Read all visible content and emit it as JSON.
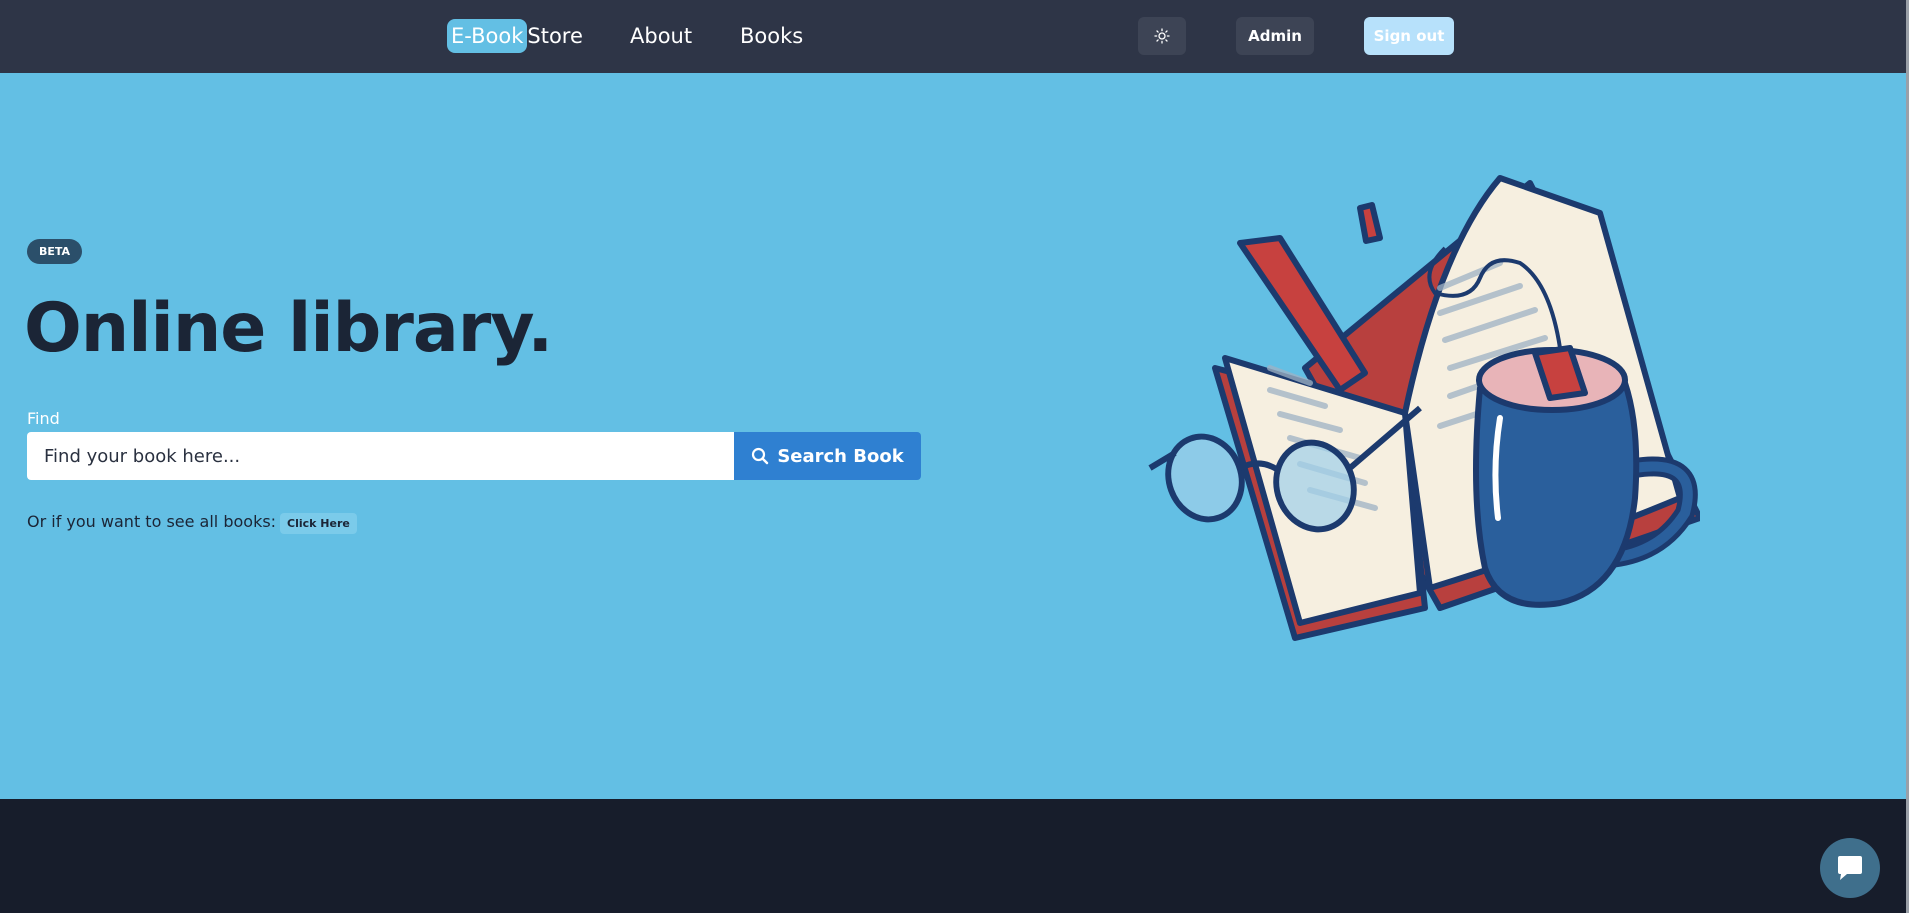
{
  "nav": {
    "brand_highlight": "E-Book",
    "brand_rest": "Store",
    "links": [
      {
        "label": "About"
      },
      {
        "label": "Books"
      }
    ],
    "theme_icon": "sun-icon",
    "admin_label": "Admin",
    "signout_label": "Sign out"
  },
  "hero": {
    "badge": "BETA",
    "title": "Online library.",
    "find_label": "Find",
    "search_placeholder": "Find your book here...",
    "search_button": "Search Book",
    "search_icon": "search-icon",
    "all_books_text": "Or if you want to see all books:",
    "click_here_label": "Click Here",
    "illustration": "open-book-with-glasses-and-mug"
  },
  "chat": {
    "icon": "chat-bubble-icon"
  },
  "colors": {
    "navbar": "#2e3547",
    "hero": "#63bfe4",
    "footer": "#171d2b",
    "search_button": "#2f80d1",
    "title": "#1b2536"
  }
}
